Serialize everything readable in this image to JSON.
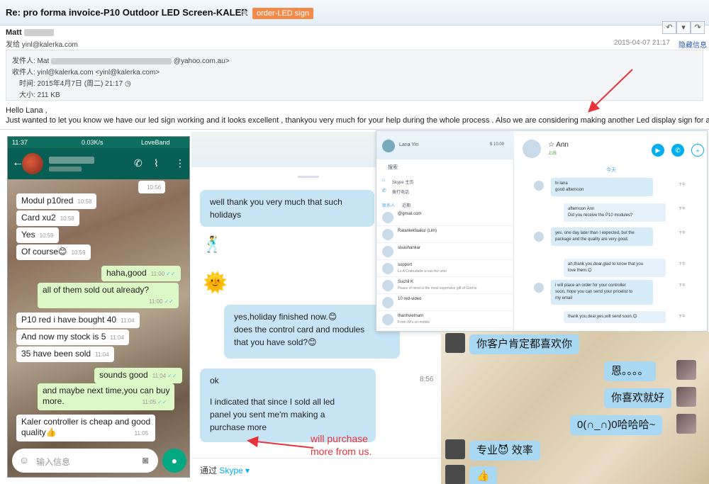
{
  "email": {
    "subject": "Re: pro forma invoice-P10 Outdoor LED Screen-KALER",
    "tag": "order-LED sign",
    "sender_name": "Matt",
    "sender_addr": "发给 yinl@kalerka.com",
    "date_right": "2015-04-07 21:17",
    "hide_info": "隐藏信息",
    "meta_from_label": "发件人: Mat",
    "meta_from_suffix": "@yahoo.com.au>",
    "meta_to": "收件人: yinl@kalerka.com <yinl@kalerka.com>",
    "meta_time": "时间: 2015年4月7日 (周二) 21:17",
    "meta_size": "大小: 211 KB",
    "greeting": "Hello Lana ,",
    "message": "Just wanted to let you know we have our led sign working and it looks excellent , thankyou very much for your help during the whole process . Also we are considering making another Led display sign for another"
  },
  "whatsapp": {
    "status_time": "11:37",
    "status_right": "0.03K/s",
    "status_carrier": "LoveBand",
    "top_time": "10:56",
    "input_placeholder": "输入信息",
    "messages": [
      {
        "text": "Modul p10red",
        "time": "10:58"
      },
      {
        "text": "Card xu2",
        "time": "10:58"
      },
      {
        "text": "Yes",
        "time": "10:59"
      },
      {
        "text": "Of course😊",
        "time": "10:59"
      },
      {
        "text": "haha,good",
        "time": "11:00"
      },
      {
        "text": "all of them sold out already?",
        "time": "11:00"
      },
      {
        "text": "P10 red i have bought 40",
        "time": "11:04"
      },
      {
        "text": "And now my stock is 5",
        "time": "11:04"
      },
      {
        "text": "35 have been sold",
        "time": "11:04"
      },
      {
        "text": "sounds good",
        "time": "11:04"
      },
      {
        "text": "and maybe next time,you can buy",
        "text2": "more.",
        "time": "11:05"
      },
      {
        "text": "Kaler controller is cheap and good",
        "text2": "quality👍",
        "time": "11:05"
      }
    ]
  },
  "skype": {
    "msg1_l1": "well thank you very much that such",
    "msg1_l2": "holidays",
    "msg2_l1": "yes,holiday finished now.😊",
    "msg2_l2": "does the control card and modules",
    "msg2_l3": "that you have sold?😊",
    "msg3_l1": "ok",
    "msg3_l2": "I indicated that since I sold all led",
    "msg3_l3": "panel you sent me'm making a",
    "msg3_l4": "purchase more",
    "time": "8:56",
    "via": "通过",
    "via_app": "Skype ▾",
    "annotation_l1": "will purchase",
    "annotation_l2": "more from us."
  },
  "skype_contacts": {
    "user": "Lana Yin",
    "balance": "$ 10.00",
    "search": "搜索",
    "home": "Skype 主页",
    "call": "拨打电话",
    "tab_contacts": "联系人",
    "tab_recent": "近期",
    "contact_name": "Ann",
    "contact_status": "上线",
    "today": "今天",
    "contacts": [
      {
        "name": "@gmail.com",
        "sub": ""
      },
      {
        "name": "Ratanlekfaakul (Lim)",
        "sub": ""
      },
      {
        "name": "sivashankar",
        "sub": ""
      },
      {
        "name": "support",
        "sub": "Lo A Crabudade a nao fez umo"
      },
      {
        "name": "Suchil K",
        "sub": "Peace of mind is the most expensive gift of God to"
      },
      {
        "name": "10 red-video",
        "sub": ""
      },
      {
        "name": "thanhvietnam",
        "sub": "From IM's on mobile"
      }
    ],
    "messages": [
      {
        "text": "hi lana\ngood afternoon",
        "time": "下午"
      },
      {
        "text": "afternoon Ann\nDid you receive the P10 modules?",
        "time": "下午"
      },
      {
        "text": "yes, one day later than I expected, but the\npackage and the quality are very good.",
        "time": "下午"
      },
      {
        "text": "ah,thank you,dear,glad to know that you\nlove them.😊",
        "time": "下午"
      },
      {
        "text": "i will place an order for your controller\nsoon, hope you can send your pricelist to\nmy email",
        "time": "下午"
      },
      {
        "text": "thank you,dear,yes,will send soon.😊",
        "time": "下午"
      }
    ]
  },
  "wechat": {
    "m1": "你客户肯定都喜欢你",
    "m2": "恩。。。。",
    "m3": "你喜欢就好",
    "m4": "0(∩_∩)0哈哈哈~",
    "m5": "专业😈 效率",
    "m6": "👍"
  },
  "colors": {
    "whatsapp_header": "#075e54",
    "whatsapp_out": "#dcf8c6",
    "skype_bubble": "#c7e4f5",
    "tag": "#f28a4a",
    "annotation": "#e8333a"
  }
}
